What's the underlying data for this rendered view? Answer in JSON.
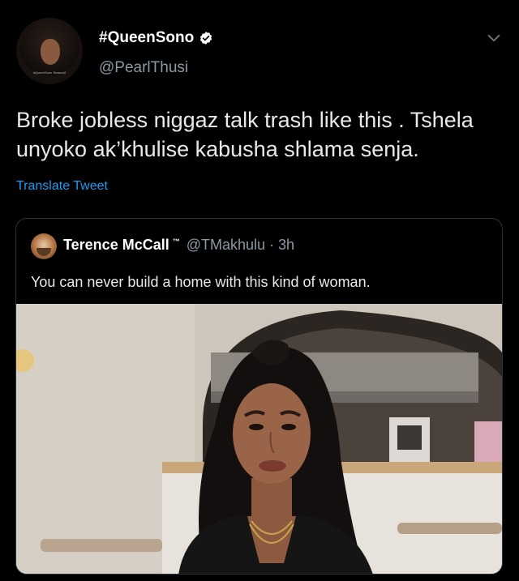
{
  "author": {
    "display_name": "#QueenSono",
    "handle": "@PearlThusi",
    "avatar_caption": "#QueenSono Season2",
    "verified": true
  },
  "tweet": {
    "text": "Broke jobless niggaz talk trash like this . Tshela unyoko ak’khulise kabusha shlama senja.",
    "translate_label": "Translate Tweet"
  },
  "quoted_tweet": {
    "display_name": "Terence McCall",
    "name_suffix": "™",
    "handle_time": "@TMakhulu · 3h",
    "text": "You can never build a home with this kind of woman."
  },
  "colors": {
    "background": "#000000",
    "link": "#1d9bf0",
    "secondary_text": "#8b98a5",
    "verified_badge": "#ffffff"
  },
  "icons": {
    "verified": "verified-badge-icon",
    "menu": "chevron-down-icon"
  }
}
